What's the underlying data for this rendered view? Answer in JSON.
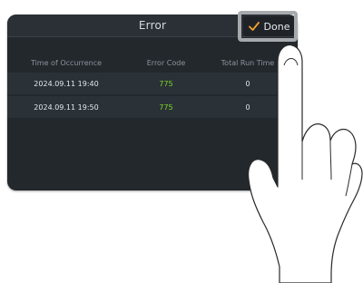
{
  "dialog": {
    "title": "Error",
    "done_label": "Done"
  },
  "table": {
    "columns": [
      "Time of Occurrence",
      "Error Code",
      "Total Run Time"
    ],
    "rows": [
      {
        "time": "2024.09.11 19:40",
        "code": "775",
        "run_time": "0"
      },
      {
        "time": "2024.09.11 19:50",
        "code": "775",
        "run_time": "0"
      }
    ]
  },
  "colors": {
    "panel_bg": "#23282d",
    "row_bg": "#2a3237",
    "error_code_green": "#7fd22a",
    "check_orange": "#f2a12b",
    "highlight_gray": "#a7aaad"
  }
}
